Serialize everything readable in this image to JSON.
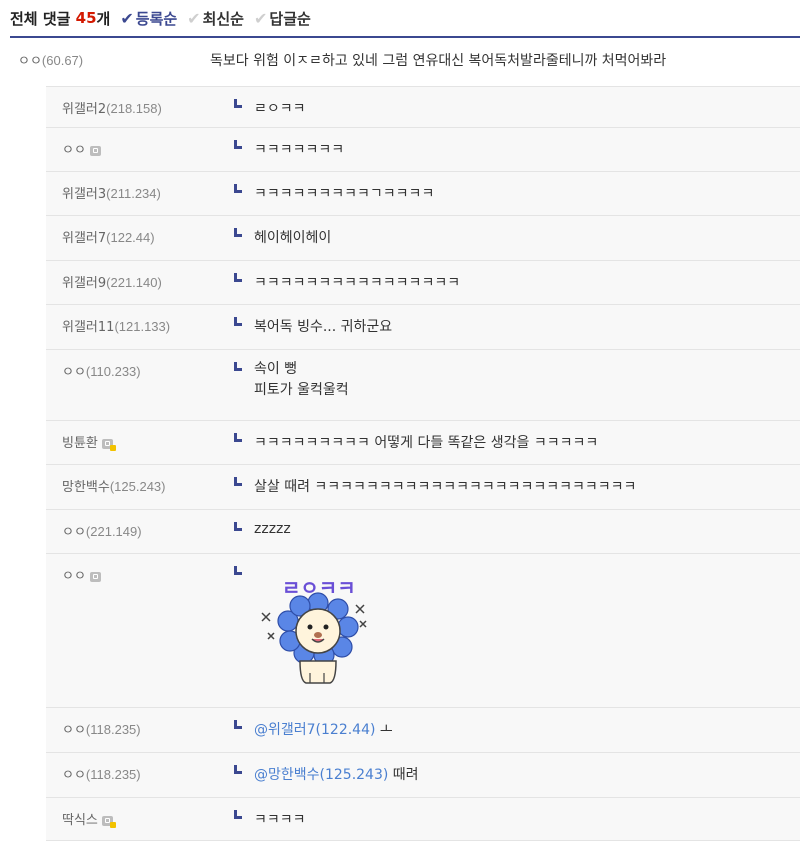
{
  "header": {
    "title": "전체 댓글",
    "count": "45",
    "count_unit": "개",
    "sorts": [
      "등록순",
      "최신순",
      "답글순"
    ],
    "active_sort": "등록순"
  },
  "main_comment": {
    "author": "ㅇㅇ",
    "ip": "(60.67)",
    "text": "독보다 위험 이ㅈㄹ하고 있네 그럼 연유대신 복어독처발라줄테니까 처먹어봐라"
  },
  "replies": [
    {
      "author": "위갤러2",
      "ip": "(218.158)",
      "text": "ㄹㅇㅋㅋ"
    },
    {
      "author": "ㅇㅇ",
      "ip": "",
      "badge": "gray",
      "text": "ㅋㅋㅋㅋㅋㅋㅋ"
    },
    {
      "author": "위갤러3",
      "ip": "(211.234)",
      "text": "ㅋㅋㅋㅋㅋㅋㅋㅋㅋㄱㅋㅋㅋㅋ"
    },
    {
      "author": "위갤러7",
      "ip": "(122.44)",
      "text": "헤이헤이헤이"
    },
    {
      "author": "위갤러9",
      "ip": "(221.140)",
      "text": "ㅋㅋㅋㅋㅋㅋㅋㅋㅋㅋㅋㅋㅋㅋㅋㅋ"
    },
    {
      "author": "위갤러11",
      "ip": "(121.133)",
      "text": "복어독 빙수... 귀하군요"
    },
    {
      "author": "ㅇㅇ",
      "ip": "(110.233)",
      "line1": "속이 뻥",
      "line2": "피토가 울컥울컥"
    },
    {
      "author": "빙튠환",
      "ip": "",
      "badge": "gold",
      "text": "ㅋㅋㅋㅋㅋㅋㅋㅋㅋ 어떻게 다들 똑같은 생각을 ㅋㅋㅋㅋㅋ"
    },
    {
      "author": "망한백수",
      "ip": "(125.243)",
      "text": "살살 때려 ㅋㅋㅋㅋㅋㅋㅋㅋㅋㅋㅋㅋㅋㅋㅋㅋㅋㅋㅋㅋㅋㅋㅋㅋㅋ"
    },
    {
      "author": "ㅇㅇ",
      "ip": "(221.149)",
      "text": "zzzzz"
    },
    {
      "author": "ㅇㅇ",
      "ip": "",
      "badge": "gray",
      "sticker_text": "ㄹㅇㅋㅋ"
    },
    {
      "author": "ㅇㅇ",
      "ip": "(118.235)",
      "mention": "@위갤러7(122.44)",
      "text": "ㅗ"
    },
    {
      "author": "ㅇㅇ",
      "ip": "(118.235)",
      "mention": "@망한백수(125.243)",
      "text": "때려"
    },
    {
      "author": "딱식스",
      "ip": "",
      "badge": "gold",
      "text": "ㅋㅋㅋㅋ"
    }
  ],
  "colors": {
    "accent": "#3b4890",
    "count": "#d31900",
    "mention": "#4a7fd0"
  }
}
